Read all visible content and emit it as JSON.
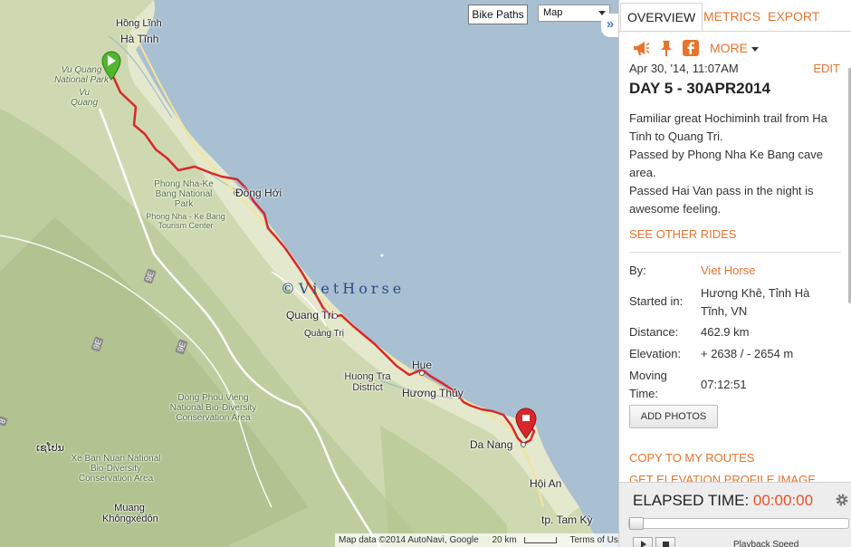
{
  "map": {
    "bike_paths_label": "Bike Paths",
    "map_type_value": "Map",
    "collapse_icon": "»",
    "watermark": "©VietHorse",
    "cities": [
      "Hồng Lĩnh",
      "Hà Tĩnh",
      "Đồng Hới",
      "Quang Tri",
      "Quảng Trị",
      "Hue",
      "Hương Thủy",
      "Da Nang",
      "Hội An",
      "tp. Tam Kỳ",
      "Muang Khôngxédôn",
      "ເຊໂປນ"
    ],
    "parks": [
      "Vu Quang National Park",
      "Vu Quang",
      "Phong Nha-Ke Bang National Park",
      "Phong Nha - Ke Bang Tourism Center",
      "Dong Phou Vieng National Bio-Diversity Conservation Area",
      "Xe Ban Nuan National Bio-Diversity Conservation Area"
    ],
    "districts": [
      "Huong Tra District"
    ],
    "road_shields": [
      "9E",
      "9E",
      "9E",
      "8"
    ],
    "footer": {
      "map_data": "Map data ©2014 AutoNavi, Google",
      "scale": "20 km",
      "terms": "Terms of Use"
    },
    "colors": {
      "route": "#d8282c",
      "water": "#a9bfd2",
      "land": "#cbd7ad",
      "start_marker": "#4fb82e",
      "end_marker": "#d8282c"
    }
  },
  "sidebar": {
    "tabs": [
      {
        "label": "OVERVIEW",
        "active": true
      },
      {
        "label": "METRICS",
        "active": false
      },
      {
        "label": "EXPORT",
        "active": false
      }
    ],
    "share": {
      "icons": [
        "megaphone-icon",
        "pin-icon",
        "facebook-icon"
      ],
      "more_label": "MORE"
    },
    "ride": {
      "date": "Apr 30, '14, 11:07AM",
      "edit_label": "EDIT",
      "title": "DAY 5 - 30APR2014",
      "description": [
        "Familiar great Hochiminh trail from Ha Tinh to Quang Tri.",
        "Passed by Phong Nha Ke Bang cave area.",
        "Passed Hai Van pass in the night is awesome feeling."
      ],
      "other_rides_label": "SEE OTHER RIDES"
    },
    "stats": {
      "by_label": "By:",
      "by_value": "Viet Horse",
      "started_label": "Started in:",
      "started_value": "Hương Khê, Tỉnh Hà Tĩnh, VN",
      "distance_label": "Distance:",
      "distance_value": "462.9 km",
      "elevation_label": "Elevation:",
      "elevation_value": "+ 2638 / - 2654 m",
      "moving_label": "Moving Time:",
      "moving_value": "07:12:51"
    },
    "actions": {
      "add_photos": "ADD PHOTOS",
      "copy_routes": "COPY TO MY ROUTES",
      "elevation_profile": "GET ELEVATION PROFILE IMAGE"
    },
    "playback": {
      "elapsed_label": "ELAPSED TIME:",
      "elapsed_value": "00:00:00",
      "progress": 0,
      "speed_label": "Playback Speed"
    },
    "colors": {
      "accent": "#e8732c",
      "elapsed": "#e8502c"
    }
  }
}
